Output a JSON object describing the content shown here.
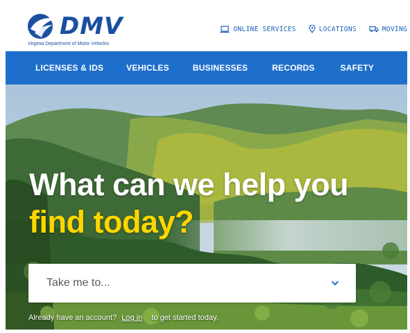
{
  "header": {
    "logo_text": "DMV",
    "logo_subtitle": "Virginia Department of Motor Vehicles",
    "utility_links": [
      {
        "label": "ONLINE SERVICES",
        "icon": "laptop-icon"
      },
      {
        "label": "LOCATIONS",
        "icon": "map-pin-icon"
      },
      {
        "label": "MOVING",
        "icon": "truck-icon"
      }
    ]
  },
  "main_nav": {
    "items": [
      {
        "label": "LICENSES & IDS"
      },
      {
        "label": "VEHICLES"
      },
      {
        "label": "BUSINESSES"
      },
      {
        "label": "RECORDS"
      },
      {
        "label": "SAFETY"
      }
    ]
  },
  "hero": {
    "title_line1": "What can we help you",
    "title_line2": "find today?",
    "dropdown_placeholder": "Take me to...",
    "account_prefix": "Already have an account?",
    "login_label": "Log in",
    "account_suffix": "to get started today."
  },
  "colors": {
    "brand_blue": "#1b4fa0",
    "nav_blue": "#1e6fcc",
    "highlight_yellow": "#ffd600"
  }
}
